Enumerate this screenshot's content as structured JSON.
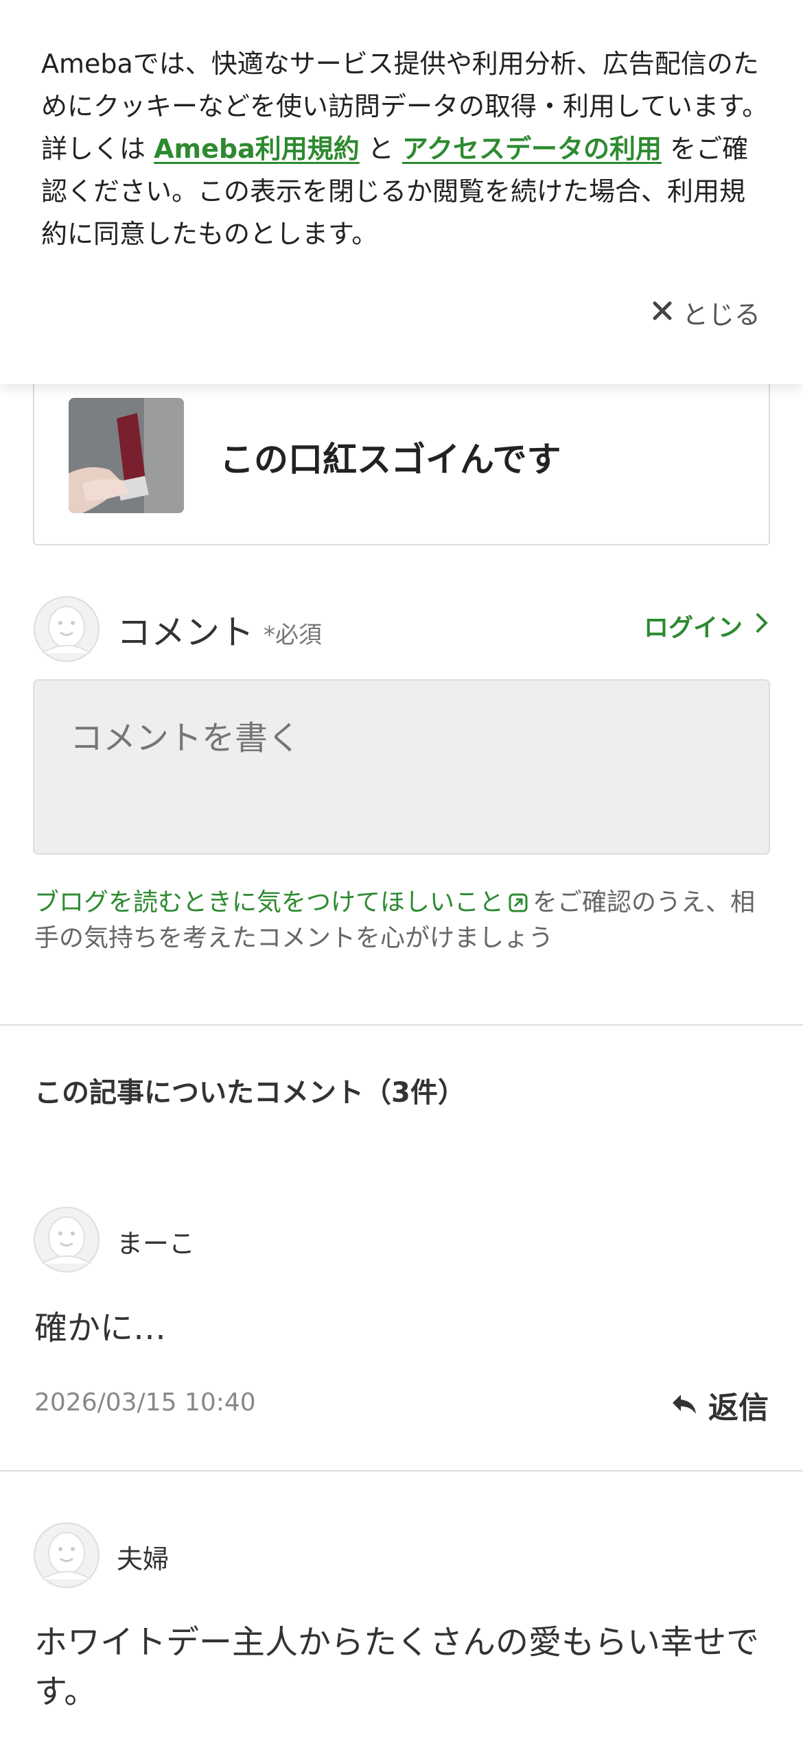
{
  "cookie_banner": {
    "text_part1": "Amebaでは、快適なサービス提供や利用分析、広告配信のためにクッキーなどを使い訪問データの取得・利用しています。詳しくは ",
    "link1": "Ameba利用規約",
    "text_part2": " と ",
    "link2": "アクセスデータの利用",
    "text_part3": " をご確認ください。この表示を閉じるか閲覧を続けた場合、利用規約に同意したものとします。",
    "close_label": "とじる"
  },
  "article": {
    "title": "この口紅スゴイんです"
  },
  "comment_form": {
    "heading": "コメント",
    "required": "*必須",
    "login_label": "ログイン",
    "placeholder": "コメントを書く",
    "guideline_link": "ブログを読むときに気をつけてほしいこと",
    "guideline_text": "をご確認のうえ、相手の気持ちを考えたコメントを心がけましょう"
  },
  "comments_section": {
    "title": "この記事についたコメント（3件）",
    "reply_label": "返信",
    "comments": [
      {
        "name": "まーこ",
        "body": "確かに…",
        "date": "2026/03/15 10:40"
      },
      {
        "name": "夫婦",
        "body": "ホワイトデー主人からたくさんの愛もらい幸せです。"
      }
    ]
  },
  "colors": {
    "accent_green": "#2d8a30",
    "text": "#333333",
    "muted": "#888888"
  }
}
